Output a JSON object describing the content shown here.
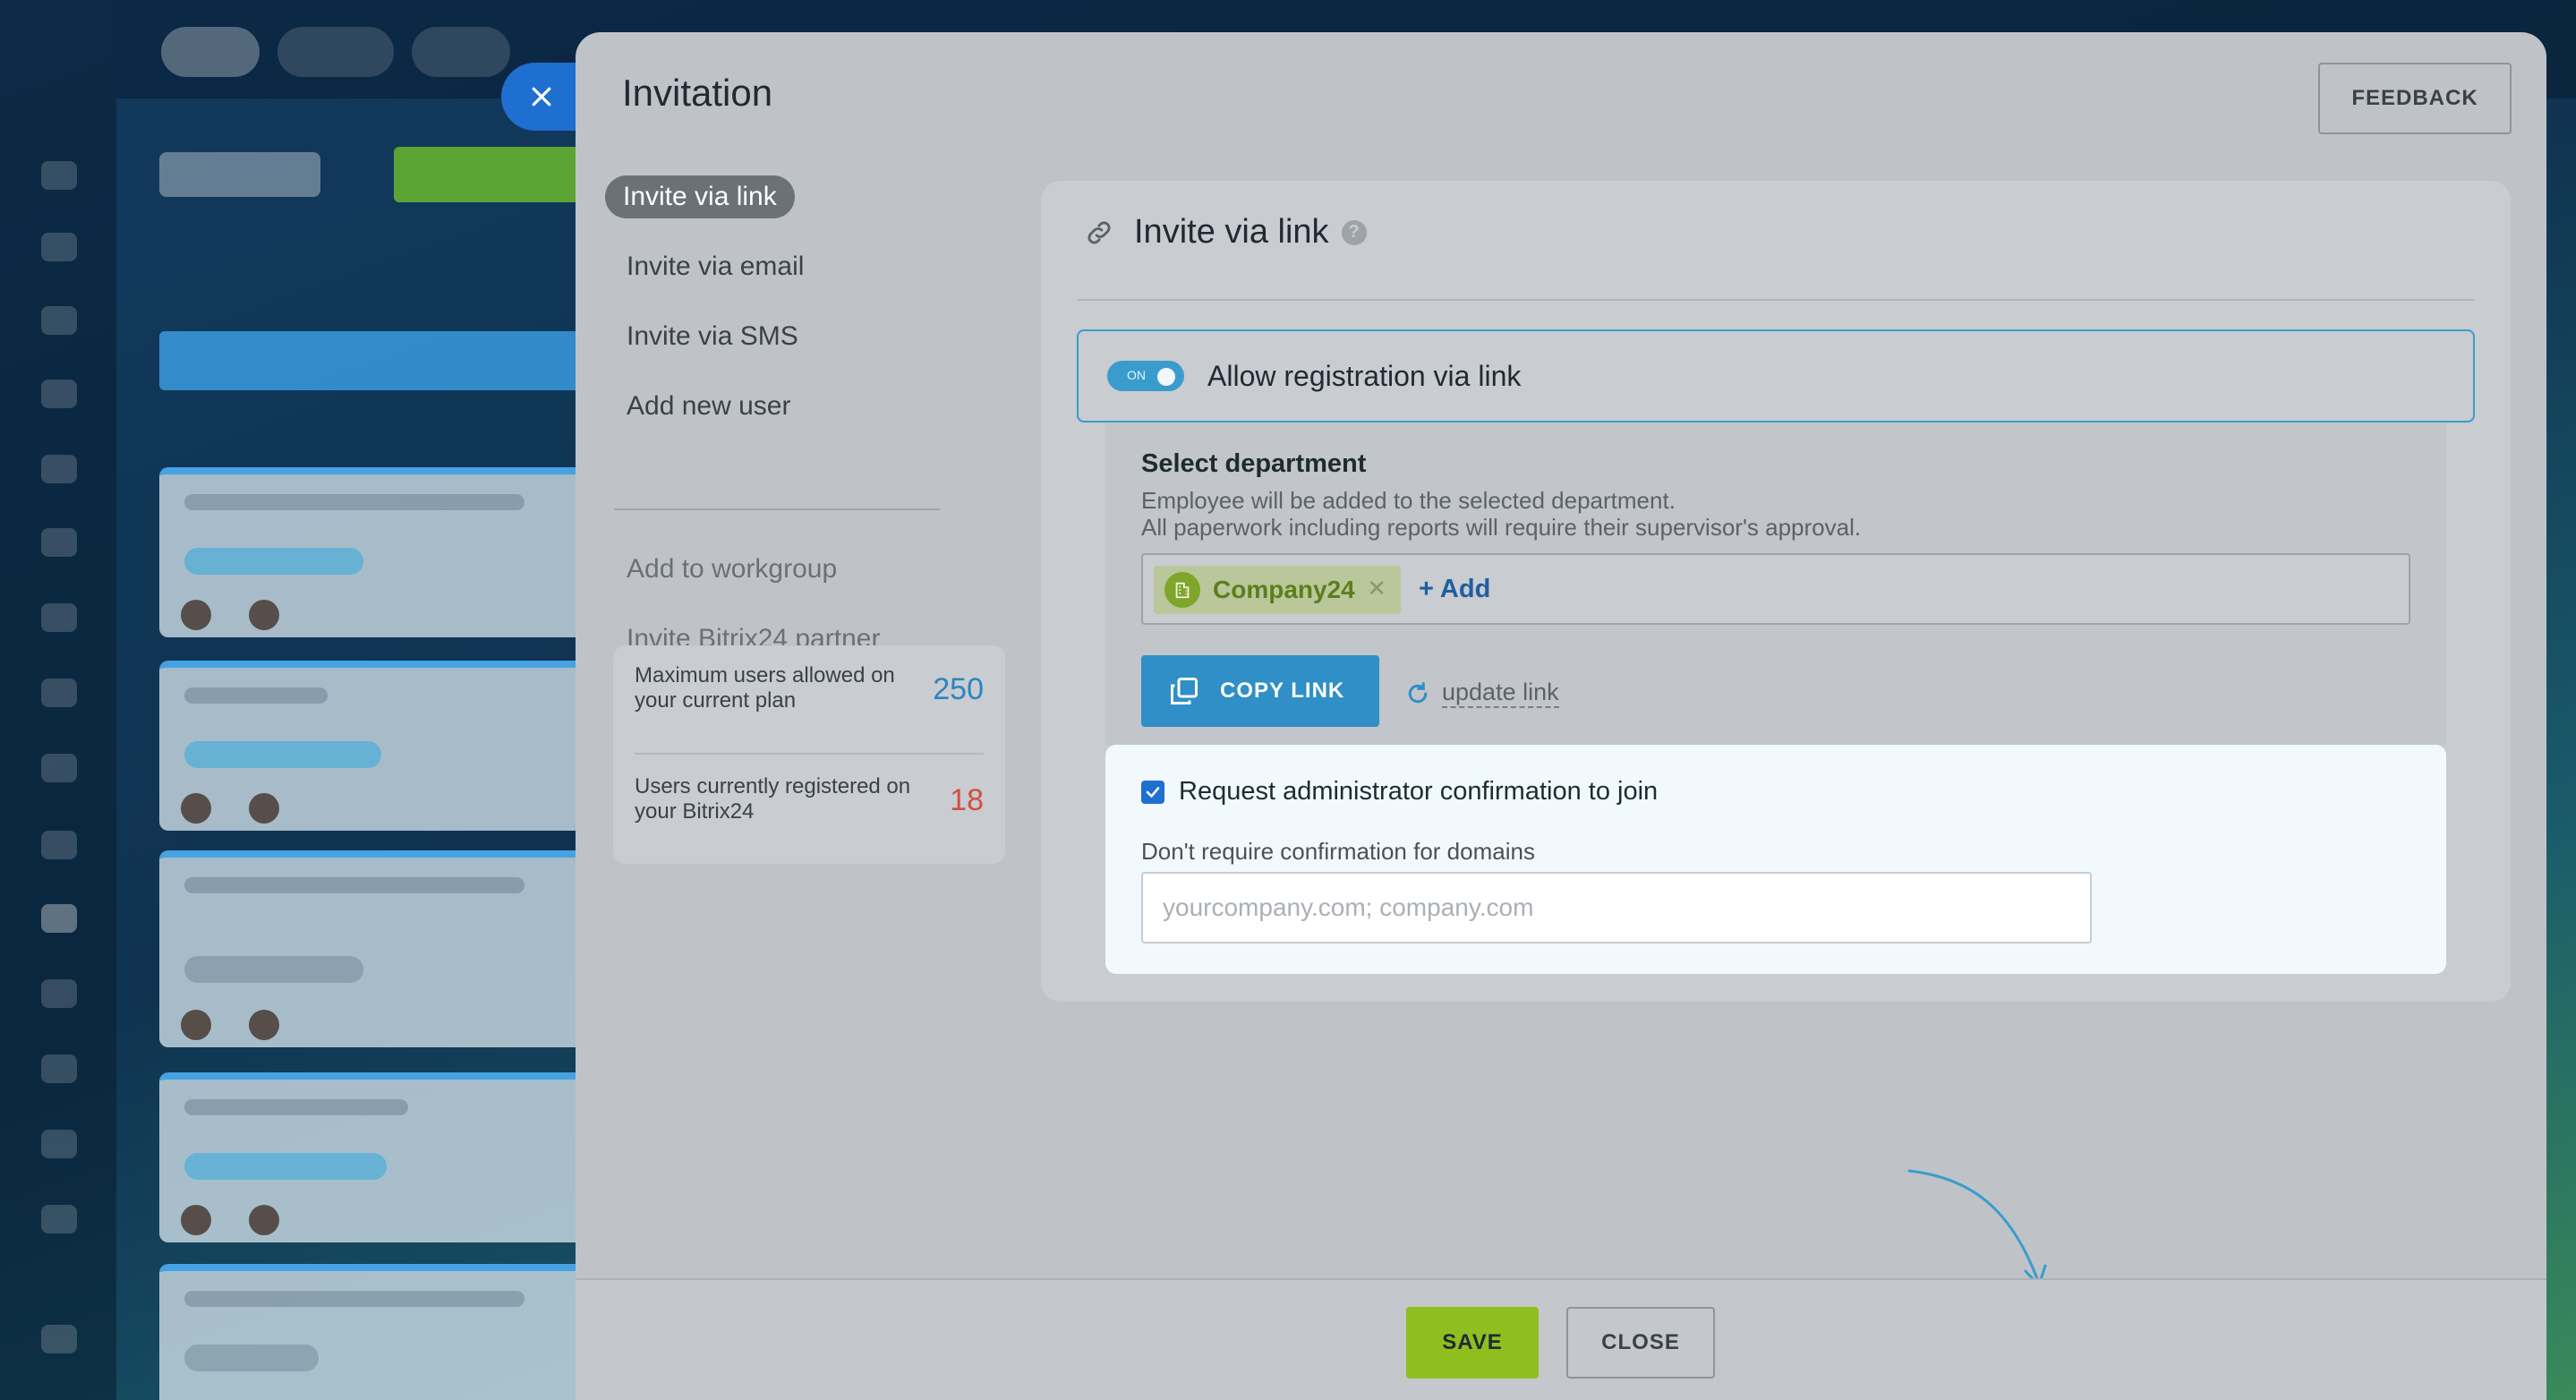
{
  "modal": {
    "title": "Invitation",
    "feedback_label": "FEEDBACK"
  },
  "nav": {
    "items": [
      {
        "label": "Invite via link",
        "active": true
      },
      {
        "label": "Invite via email"
      },
      {
        "label": "Invite via SMS"
      },
      {
        "label": "Add new user"
      }
    ],
    "secondary": [
      {
        "label": "Add to workgroup"
      },
      {
        "label": "Invite Bitrix24 partner"
      }
    ]
  },
  "stats": {
    "max_users_label": "Maximum users allowed on your current plan",
    "max_users_value": "250",
    "registered_label": "Users currently registered on your Bitrix24",
    "registered_value": "18"
  },
  "panel": {
    "title": "Invite via link",
    "help": "?",
    "toggle_state": "ON",
    "toggle_label": "Allow registration via link",
    "department": {
      "heading": "Select department",
      "desc_line1": "Employee will be added to the selected department.",
      "desc_line2": "All paperwork including reports will require their supervisor's approval.",
      "tag": "Company24",
      "add_label": "+ Add"
    },
    "copy_link_label": "COPY LINK",
    "update_link_label": "update link",
    "confirmation": {
      "checkbox_label": "Request administrator confirmation to join",
      "checked": true,
      "domains_label": "Don't require confirmation for domains",
      "domains_value": "",
      "domains_placeholder": "yourcompany.com; company.com"
    }
  },
  "footer": {
    "save_label": "SAVE",
    "close_label": "CLOSE"
  },
  "colors": {
    "accent_blue": "#2f8fc6",
    "save_green": "#8fbe1f",
    "max_value": "#2a86c0",
    "registered_value": "#d0513e"
  }
}
